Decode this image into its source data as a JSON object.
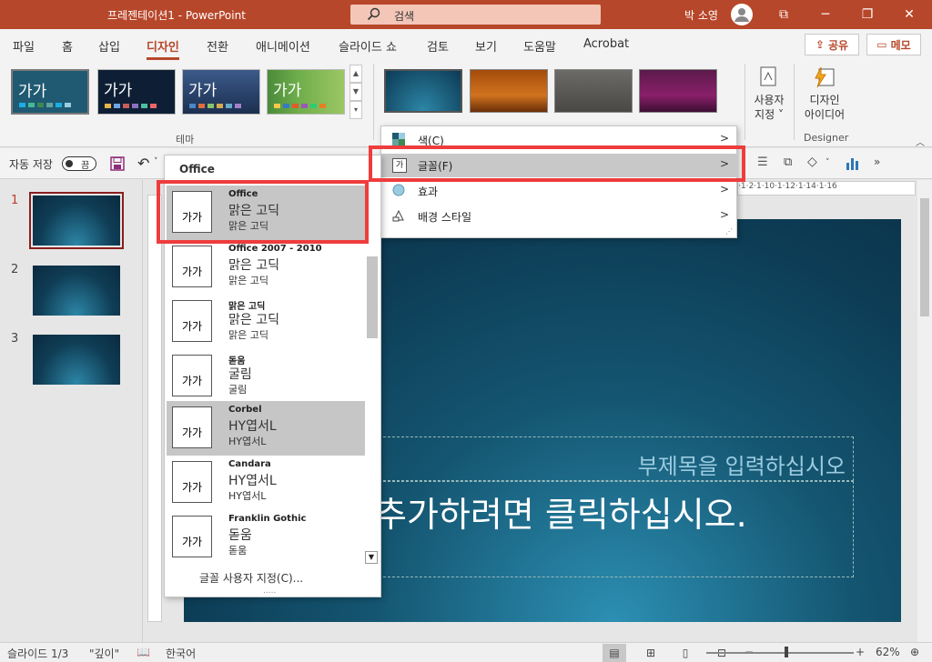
{
  "window": {
    "title": "프레젠테이션1  -  PowerPoint",
    "search_label": "검색",
    "user_name": "박 소영",
    "controls": {
      "ribbon_display": "⧉",
      "minimize": "─",
      "restore": "❐",
      "close": "✕"
    }
  },
  "ribbon_tabs": [
    {
      "label": "파일"
    },
    {
      "label": "홈"
    },
    {
      "label": "삽입"
    },
    {
      "label": "디자인"
    },
    {
      "label": "전환"
    },
    {
      "label": "애니메이션"
    },
    {
      "label": "슬라이드 쇼"
    },
    {
      "label": "검토"
    },
    {
      "label": "보기"
    },
    {
      "label": "도움말"
    },
    {
      "label": "Acrobat"
    }
  ],
  "share_label": "공유",
  "memo_label": "메모",
  "themes": {
    "group_label": "테마",
    "items": [
      {
        "glyph": "가가"
      },
      {
        "glyph": "가가"
      },
      {
        "glyph": "가가"
      },
      {
        "glyph": "가가"
      }
    ]
  },
  "design": {
    "custom_size_label": "사용자\n지정 ˅",
    "designer_label": "디자인\n아이디어",
    "group_label": "Designer"
  },
  "qat": {
    "autosave_label": "자동 저장",
    "toggle_state": "끔"
  },
  "variants_menu": {
    "items": [
      {
        "label": "색(C)"
      },
      {
        "label": "글꼴(F)"
      },
      {
        "label": "효과"
      },
      {
        "label": "배경 스타일"
      }
    ]
  },
  "fonts_dropdown": {
    "header": "Office",
    "items": [
      {
        "name": "Office",
        "heading": "맑은 고딕",
        "body": "맑은 고딕",
        "preview": "가가"
      },
      {
        "name": "Office 2007 - 2010",
        "heading": "맑은 고딕",
        "body": "맑은 고딕",
        "preview": "가가"
      },
      {
        "name": "맑은 고딕",
        "heading": "맑은 고딕",
        "body": "맑은 고딕",
        "preview": "가가"
      },
      {
        "name": "돋움",
        "heading": "굴림",
        "body": "굴림",
        "preview": "가가"
      },
      {
        "name": "Corbel",
        "heading": "HY엽서L",
        "body": "HY엽서L",
        "preview": "가가"
      },
      {
        "name": "Candara",
        "heading": "HY엽서L",
        "body": "HY엽서L",
        "preview": "가가"
      },
      {
        "name": "Franklin Gothic",
        "heading": "돋움",
        "body": "돋움",
        "preview": "가가"
      }
    ],
    "footer": "글꼴 사용자 지정(C)...",
    "grip": "....."
  },
  "slides": [
    {
      "num": "1"
    },
    {
      "num": "2"
    },
    {
      "num": "3"
    }
  ],
  "slide": {
    "subtitle": "부제목을 입력하십시오",
    "title": "추가하려면 클릭하십시오."
  },
  "ruler_text": "·1·2·1·10·1·12·1·14·1·16",
  "status": {
    "slide_info": "슬라이드 1/3",
    "theme_name": "\"깊이\"",
    "language": "한국어",
    "zoom": "62%"
  },
  "colors": {
    "accent": "#b7472a",
    "highlight_box": "#ef3c3c",
    "slide_bg": "#0d3d56"
  }
}
